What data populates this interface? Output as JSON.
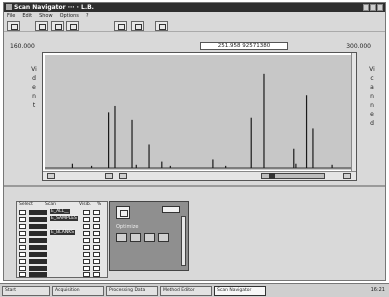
{
  "window": {
    "title": "Scan Navigator ··· · L.B.",
    "minimize_label": "",
    "maximize_label": "",
    "close_label": ""
  },
  "menu": [
    "File",
    "Edit",
    "Show",
    "Options",
    "?"
  ],
  "toolbar": {
    "buttons": [
      "open-icon",
      "save-icon",
      "print-icon",
      "copy-icon",
      "window-icon",
      "chart-icon",
      "exit-icon"
    ]
  },
  "plot": {
    "range_min": "160.000",
    "range_max": "300.000",
    "cursor_readout": "251.958 92571380",
    "y_axis_label": "Vi",
    "y_axis_label_right": "Vi",
    "left_axis_letters": [
      "d",
      "e",
      "n",
      "t"
    ],
    "right_axis_letters": [
      "c",
      "a",
      "n",
      "n",
      "e",
      "d"
    ]
  },
  "chart_data": {
    "type": "bar",
    "xlim": [
      160,
      300
    ],
    "ylim": [
      0,
      100
    ],
    "x": [
      171,
      180,
      188,
      191,
      199,
      201,
      207,
      213,
      217,
      237,
      243,
      255,
      261,
      275,
      276,
      281,
      284,
      293
    ],
    "values": [
      4,
      2,
      52,
      58,
      45,
      3,
      22,
      6,
      2,
      8,
      2,
      47,
      88,
      18,
      4,
      68,
      37,
      3
    ],
    "grid": false
  },
  "selection_list": {
    "header": [
      "Select",
      "Scan",
      "Visib.",
      "%"
    ],
    "rows": [
      {
        "name": "E_ALL__"
      },
      {
        "name": "E_SAMPLES"
      },
      {
        "name": ""
      },
      {
        "name": "E_BLANKS"
      },
      {
        "name": ""
      },
      {
        "name": ""
      },
      {
        "name": ""
      },
      {
        "name": ""
      },
      {
        "name": ""
      },
      {
        "name": ""
      }
    ]
  },
  "image_panel": {
    "caption": "Optimize"
  },
  "taskbar": {
    "items": [
      "Start",
      "Acquisition",
      "Processing Data",
      "Method Editor",
      "Instrument Control",
      "Scan Navigator"
    ],
    "clock": "16:21"
  }
}
